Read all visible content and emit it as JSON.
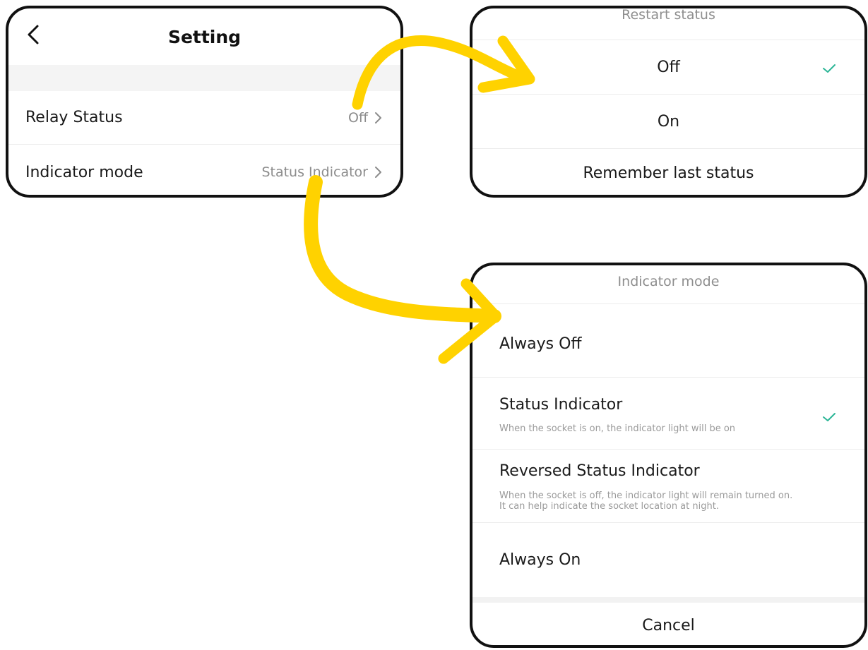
{
  "setting": {
    "title": "Setting",
    "rows": [
      {
        "label": "Relay Status",
        "value": "Off"
      },
      {
        "label": "Indicator mode",
        "value": "Status Indicator"
      }
    ]
  },
  "restart_sheet": {
    "title": "Restart status",
    "options": [
      {
        "label": "Off",
        "selected": true
      },
      {
        "label": "On",
        "selected": false
      },
      {
        "label": "Remember last status",
        "selected": false
      }
    ]
  },
  "indicator_sheet": {
    "title": "Indicator mode",
    "options": [
      {
        "label": "Always Off",
        "description": "",
        "selected": false
      },
      {
        "label": "Status Indicator",
        "description": "When the socket is on, the indicator light will be on",
        "selected": true
      },
      {
        "label": "Reversed Status Indicator",
        "description_line1": "When the socket is off, the indicator light will remain turned on.",
        "description_line2": "It can help indicate the socket location at night.",
        "selected": false
      },
      {
        "label": "Always On",
        "description": "",
        "selected": false
      }
    ],
    "cancel_label": "Cancel"
  },
  "colors": {
    "accent_check": "#2bb596",
    "arrow": "#ffd200",
    "border": "#111111"
  },
  "icons": [
    "back-icon",
    "chevron-right-icon",
    "checkmark-icon"
  ]
}
